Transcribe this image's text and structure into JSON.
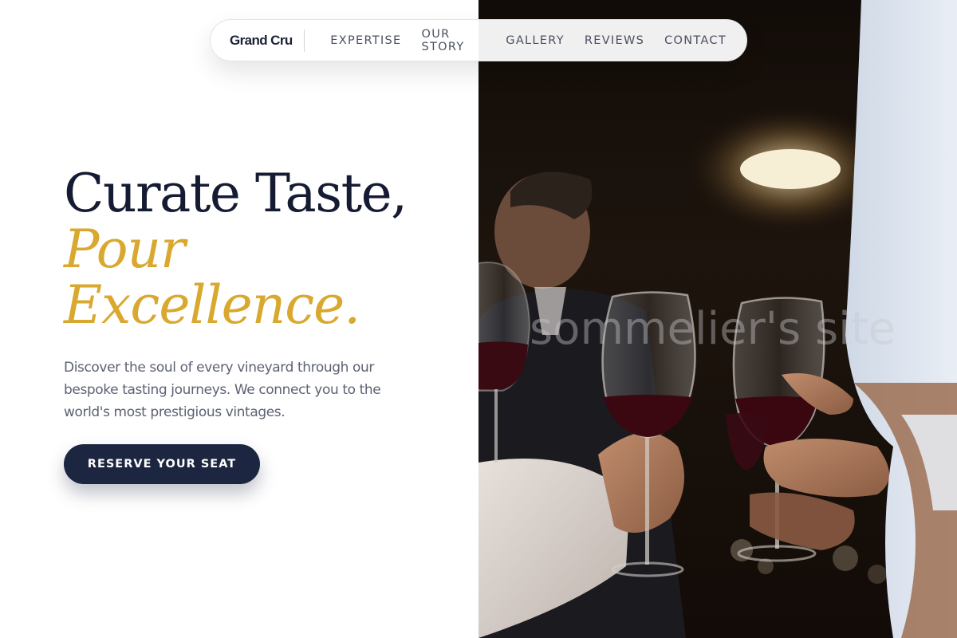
{
  "nav": {
    "brand": "Grand Cru",
    "links": [
      "EXPERTISE",
      "OUR STORY",
      "GALLERY",
      "REVIEWS",
      "CONTACT"
    ]
  },
  "hero": {
    "headline_line1": "Curate Taste,",
    "headline_line2": "Pour",
    "headline_line3": "Excellence.",
    "description": "Discover the soul of every vineyard through our bespoke tasting journeys. We connect you to the world's most prestigious vintages.",
    "cta_label": "RESERVE YOUR SEAT"
  },
  "photo": {
    "watermark": "sommelier's site"
  },
  "colors": {
    "navy": "#141b33",
    "gold": "#d9a82e",
    "button": "#1d2640",
    "body_text": "#5c6272"
  }
}
